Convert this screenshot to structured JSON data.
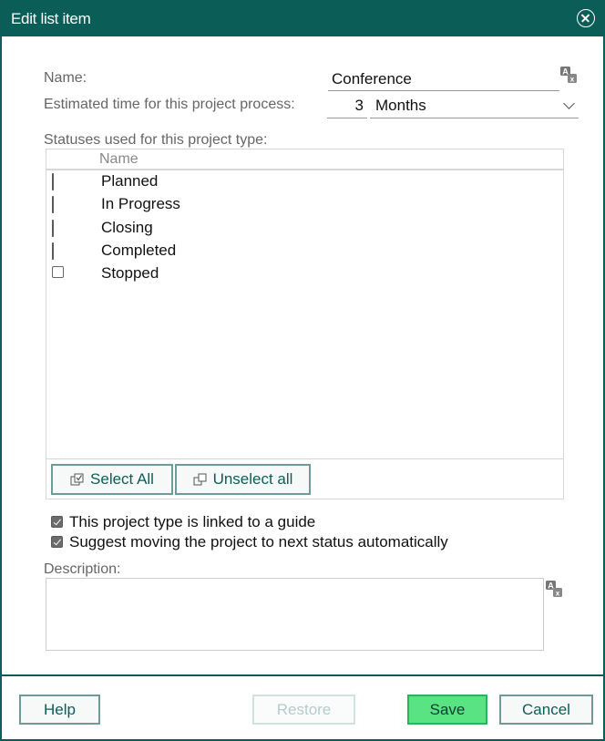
{
  "dialog": {
    "title": "Edit list item",
    "close_icon": "close-circle-icon"
  },
  "form": {
    "name_label": "Name:",
    "name_value": "Conference",
    "translate_icon": "translate-icon",
    "estimated_label": "Estimated time for this project process:",
    "estimated_value": "3",
    "unit_value": "Months",
    "statuses_label": "Statuses used for this project type:"
  },
  "statuses": {
    "column_header": "Name",
    "items": [
      {
        "label": "Planned",
        "checked": true
      },
      {
        "label": "In Progress",
        "checked": true
      },
      {
        "label": "Closing",
        "checked": true
      },
      {
        "label": "Completed",
        "checked": true
      },
      {
        "label": "Stopped",
        "checked": false
      }
    ],
    "select_all_label": "Select All",
    "unselect_all_label": "Unselect all"
  },
  "options": [
    {
      "label": "This project type is linked to a guide",
      "checked": true
    },
    {
      "label": "Suggest moving the project to next status automatically",
      "checked": true
    }
  ],
  "description": {
    "label": "Description:",
    "value": ""
  },
  "footer": {
    "help_label": "Help",
    "restore_label": "Restore",
    "save_label": "Save",
    "cancel_label": "Cancel"
  },
  "colors": {
    "brand": "#0b5e58",
    "save": "#5ae383",
    "button_border": "#6f9a98"
  }
}
